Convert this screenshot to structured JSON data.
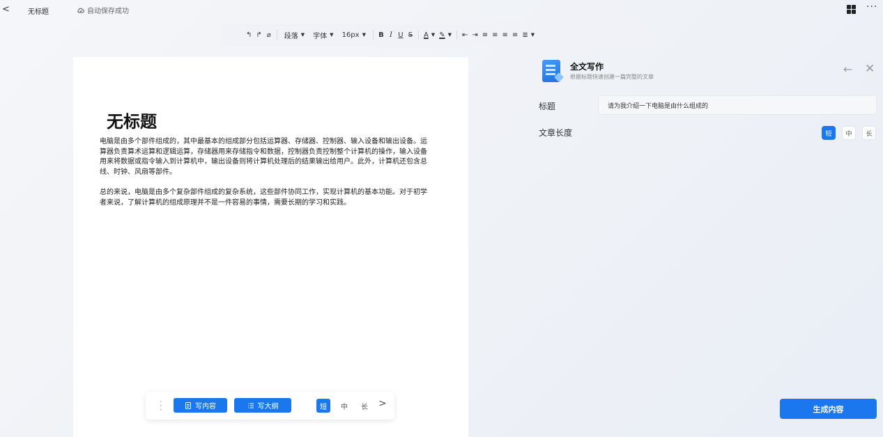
{
  "topbar": {
    "back_glyph": "<",
    "doc_name": "无标题",
    "save_status": "自动保存成功",
    "more_glyph": "···"
  },
  "toolbar": {
    "undo": "↰",
    "redo": "↱",
    "clear": "⌀",
    "paragraph": "段落",
    "font": "字体",
    "size": "16px",
    "bold": "B",
    "italic": "I",
    "underline": "U",
    "strike": "S",
    "font_color": "A",
    "highlight": "✎",
    "outdent": "⇤",
    "indent": "⇥",
    "align_left": "≡",
    "align_center": "≡",
    "align_right": "≡",
    "justify": "≡",
    "line_spacing": "≣"
  },
  "document": {
    "title": "无标题",
    "paragraphs": [
      "电脑是由多个部件组成的，其中最基本的组成部分包括运算器、存储器、控制器、输入设备和输出设备。运算器负责算术运算和逻辑运算，存储器用来存储指令和数据，控制器负责控制整个计算机的操作，输入设备用来将数据或指令输入到计算机中，输出设备则将计算机处理后的结果输出给用户。此外，计算机还包含总线、时钟、风扇等部件。",
      "总的来说，电脑是由多个复杂部件组成的复杂系统，这些部件协同工作，实现计算机的基本功能。对于初学者来说，了解计算机的组成原理并不是一件容易的事情，需要长期的学习和实践。"
    ]
  },
  "floatbar": {
    "write_content": "写内容",
    "write_outline": "写大纲",
    "len_short": "短",
    "len_medium": "中",
    "len_long": "长",
    "selected_length": "短",
    "next": ">"
  },
  "panel": {
    "title": "全文写作",
    "subtitle": "根据标题快速创建一篇完整的文章",
    "back_glyph": "←",
    "close_glyph": "✕",
    "label_title": "标题",
    "title_value": "请为我介绍一下电脑是由什么组成的",
    "label_length": "文章长度",
    "len_short": "短",
    "len_medium": "中",
    "len_long": "长",
    "selected_length": "短",
    "generate": "生成内容"
  },
  "colors": {
    "accent": "#1b77ee",
    "paper": "#ffffff",
    "background": "#eef1f6"
  }
}
